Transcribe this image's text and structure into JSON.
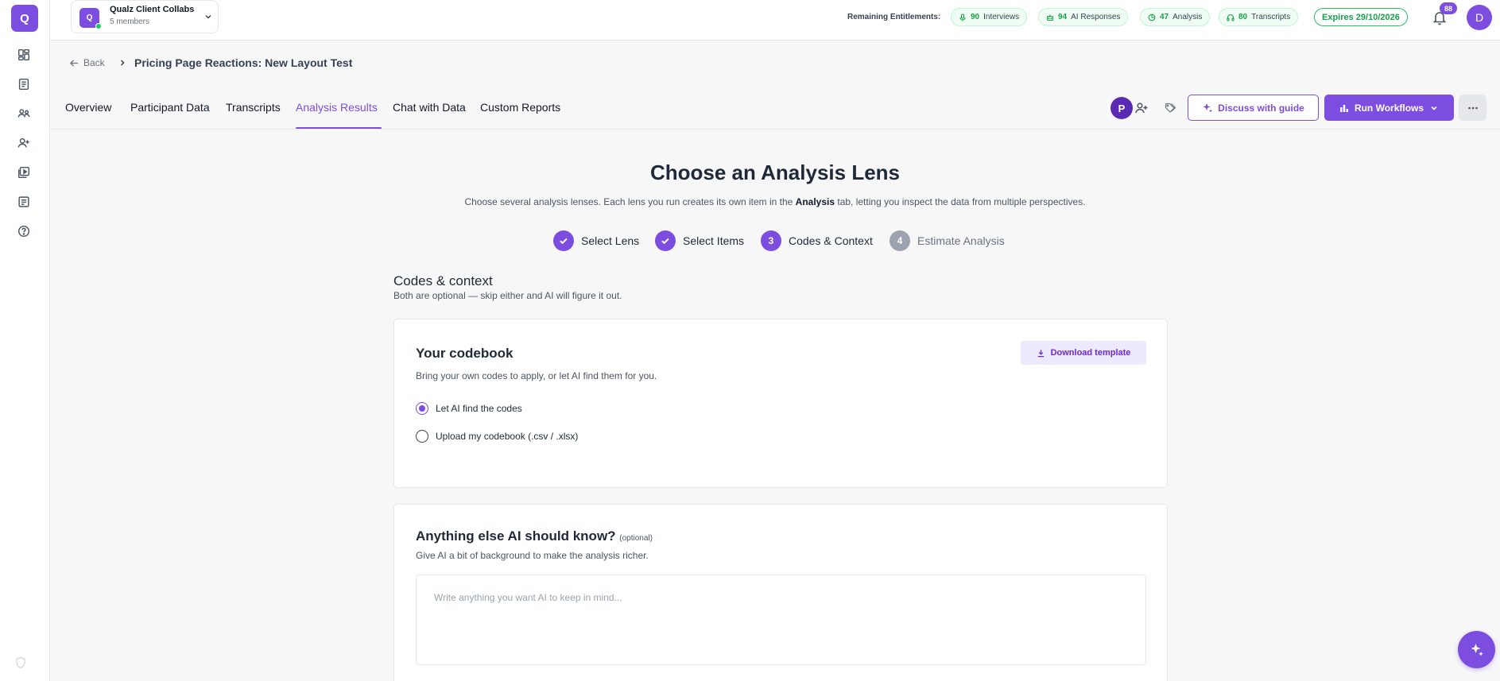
{
  "app": {
    "logo_letter": "Q",
    "accent": "#7c4dde"
  },
  "workspace": {
    "avatar_letter": "Q",
    "name": "Qualz Client Collabs",
    "members": "5 members"
  },
  "entitlements": {
    "label": "Remaining Entitlements:",
    "items": [
      {
        "value": "90",
        "label": "Interviews",
        "icon": "mic-icon"
      },
      {
        "value": "94",
        "label": "AI Responses",
        "icon": "robot-icon"
      },
      {
        "value": "47",
        "label": "Analysis",
        "icon": "chart-pie-icon"
      },
      {
        "value": "80",
        "label": "Transcripts",
        "icon": "headphones-icon"
      }
    ],
    "expires": "Expires 29/10/2026"
  },
  "notifications": {
    "count": "88"
  },
  "user": {
    "initial": "D"
  },
  "breadcrumb": {
    "back": "Back",
    "title": "Pricing Page Reactions: New Layout Test"
  },
  "tabs": [
    {
      "label": "Overview"
    },
    {
      "label": "Participant Data"
    },
    {
      "label": "Transcripts"
    },
    {
      "label": "Analysis Results",
      "active": true
    },
    {
      "label": "Chat with Data"
    },
    {
      "label": "Custom Reports"
    }
  ],
  "toolbar": {
    "participant_initial": "P",
    "discuss_label": "Discuss with guide",
    "run_label": "Run Workflows"
  },
  "main": {
    "title": "Choose an Analysis Lens",
    "subtitle_pre": "Choose several analysis lenses. Each lens you run creates its own item in the ",
    "subtitle_bold": "Analysis",
    "subtitle_post": " tab, letting you inspect the data from multiple perspectives."
  },
  "steps": [
    {
      "label": "Select Lens",
      "state": "done"
    },
    {
      "label": "Select Items",
      "state": "done"
    },
    {
      "number": "3",
      "label": "Codes & Context",
      "state": "current"
    },
    {
      "number": "4",
      "label": "Estimate Analysis",
      "state": "upcoming"
    }
  ],
  "section": {
    "title": "Codes & context",
    "subtitle": "Both are optional — skip either and AI will figure it out."
  },
  "codebook": {
    "title": "Your codebook",
    "subtitle": "Bring your own codes to apply, or let AI find them for you.",
    "download_label": "Download template",
    "options": [
      {
        "label": "Let AI find the codes",
        "checked": true
      },
      {
        "label": "Upload my codebook (.csv / .xlsx)",
        "checked": false
      }
    ]
  },
  "context": {
    "title": "Anything else AI should know?",
    "optional": "(optional)",
    "subtitle": "Give AI a bit of background to make the analysis richer.",
    "placeholder": "Write anything you want AI to keep in mind..."
  }
}
